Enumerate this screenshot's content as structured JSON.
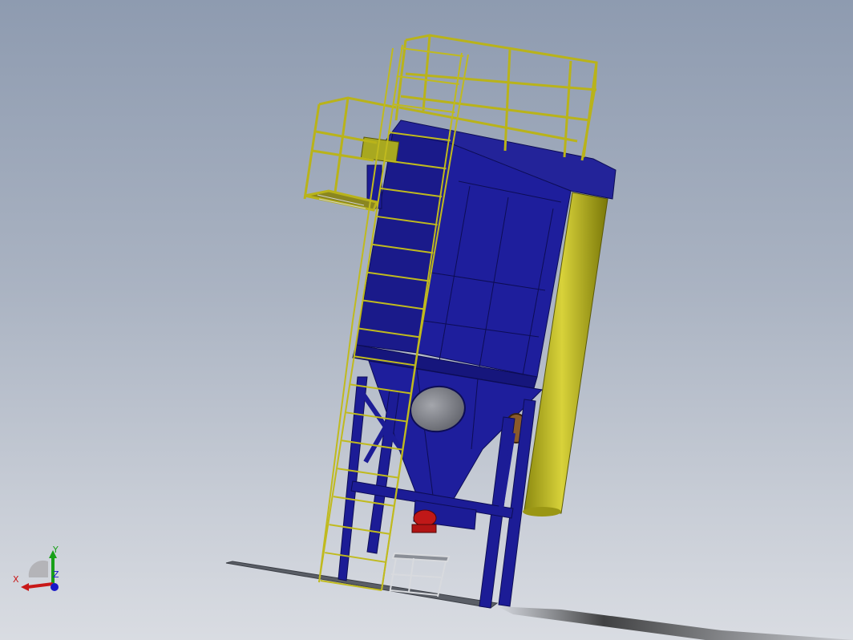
{
  "view": {
    "background_top": "#8e9bb0",
    "background_bottom": "#d9dce2"
  },
  "model": {
    "body_color": "#1c1c96",
    "railing_color": "#b9b31a",
    "duct_color": "#a8a820",
    "window_color": "#7e8088",
    "motor_color": "#c01818"
  },
  "triad": {
    "x_label": "X",
    "y_label": "Y",
    "z_label": "Z",
    "x_color": "#c81818",
    "y_color": "#18a018",
    "z_color": "#1818c8"
  }
}
